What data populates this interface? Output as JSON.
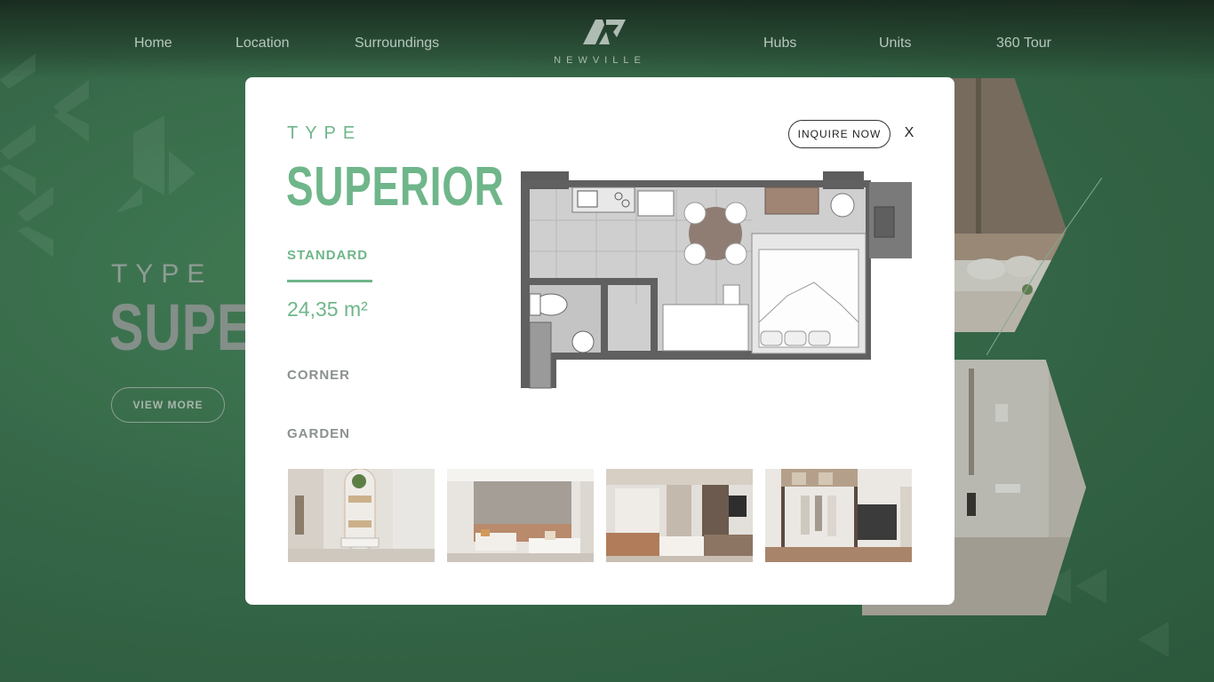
{
  "nav": {
    "items": [
      "Home",
      "Location",
      "Surroundings",
      "Hubs",
      "Units",
      "360 Tour"
    ],
    "logo_text": "NEWVILLE"
  },
  "hero": {
    "type_label": "TYPE",
    "title": "SUPERIOR",
    "button": "VIEW MORE"
  },
  "modal": {
    "type_label": "TYPE",
    "title": "SUPERIOR",
    "tabs": {
      "standard": "STANDARD",
      "corner": "CORNER",
      "garden": "GARDEN"
    },
    "area": "24,35 m²",
    "inquire_button": "INQUIRE NOW",
    "close_label": "X",
    "thumbnails": [
      "bathroom-photo",
      "bedroom-photo",
      "living-room-photo",
      "wardrobe-photo"
    ]
  },
  "colors": {
    "accent": "#6fb68a",
    "background": "#3f7552",
    "modal_bg": "#ffffff"
  }
}
